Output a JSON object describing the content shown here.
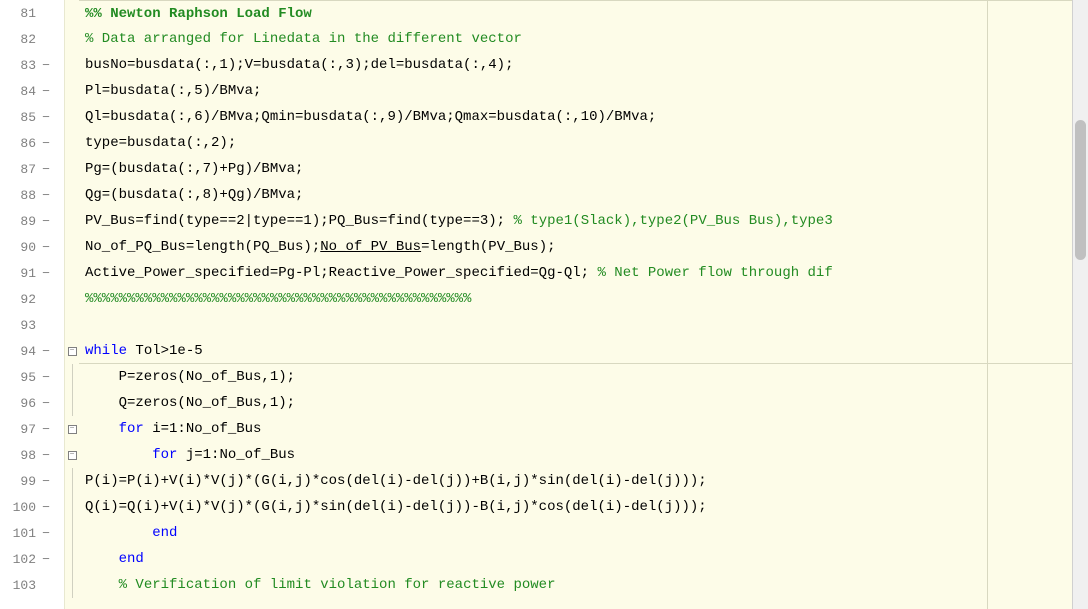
{
  "lines": [
    {
      "num": "81",
      "marker": "",
      "fold": "",
      "tokens": [
        {
          "cls": "section-title",
          "text": "%% Newton Raphson Load Flow"
        }
      ],
      "section": true
    },
    {
      "num": "82",
      "marker": "",
      "fold": "",
      "tokens": [
        {
          "cls": "comment",
          "text": "% Data arranged for Linedata in the different vector"
        }
      ]
    },
    {
      "num": "83",
      "marker": "−",
      "fold": "",
      "tokens": [
        {
          "cls": "text-code",
          "text": "busNo=busdata(:,1);V=busdata(:,3);del=busdata(:,4);"
        }
      ]
    },
    {
      "num": "84",
      "marker": "−",
      "fold": "",
      "tokens": [
        {
          "cls": "text-code",
          "text": "Pl=busdata(:,5)/BMva;"
        }
      ]
    },
    {
      "num": "85",
      "marker": "−",
      "fold": "",
      "tokens": [
        {
          "cls": "text-code",
          "text": "Ql=busdata(:,6)/BMva;Qmin=busdata(:,9)/BMva;Qmax=busdata(:,10)/BMva;"
        }
      ]
    },
    {
      "num": "86",
      "marker": "−",
      "fold": "",
      "tokens": [
        {
          "cls": "text-code",
          "text": "type=busdata(:,2);"
        }
      ]
    },
    {
      "num": "87",
      "marker": "−",
      "fold": "",
      "tokens": [
        {
          "cls": "text-code",
          "text": "Pg=(busdata(:,7)+Pg)/BMva;"
        }
      ]
    },
    {
      "num": "88",
      "marker": "−",
      "fold": "",
      "tokens": [
        {
          "cls": "text-code",
          "text": "Qg=(busdata(:,8)+Qg)/BMva;"
        }
      ]
    },
    {
      "num": "89",
      "marker": "−",
      "fold": "",
      "tokens": [
        {
          "cls": "text-code",
          "text": "PV_Bus=find(type==2|type==1);PQ_Bus=find(type==3); "
        },
        {
          "cls": "comment",
          "text": "% type1(Slack),type2(PV_Bus Bus),type3"
        }
      ]
    },
    {
      "num": "90",
      "marker": "−",
      "fold": "",
      "tokens": [
        {
          "cls": "text-code",
          "text": "No_of_PQ_Bus=length(PQ_Bus);"
        },
        {
          "cls": "text-code underlined",
          "text": "No_of_PV_Bus"
        },
        {
          "cls": "text-code",
          "text": "=length(PV_Bus);"
        }
      ]
    },
    {
      "num": "91",
      "marker": "−",
      "fold": "",
      "tokens": [
        {
          "cls": "text-code",
          "text": "Active_Power_specified=Pg-Pl;Reactive_Power_specified=Qg-Ql; "
        },
        {
          "cls": "comment",
          "text": "% Net Power flow through dif"
        }
      ]
    },
    {
      "num": "92",
      "marker": "",
      "fold": "",
      "tokens": [
        {
          "cls": "comment",
          "text": "%%%%%%%%%%%%%%%%%%%%%%%%%%%%%%%%%%%%%%%%%%%%%%"
        }
      ]
    },
    {
      "num": "93",
      "marker": "",
      "fold": "",
      "tokens": []
    },
    {
      "num": "94",
      "marker": "−",
      "fold": "box",
      "tokens": [
        {
          "cls": "keyword",
          "text": "while"
        },
        {
          "cls": "text-code",
          "text": " Tol>1e-5"
        }
      ],
      "sectionBottom": true
    },
    {
      "num": "95",
      "marker": "−",
      "fold": "line",
      "tokens": [
        {
          "cls": "text-code",
          "text": "    P=zeros(No_of_Bus,1);"
        }
      ]
    },
    {
      "num": "96",
      "marker": "−",
      "fold": "line",
      "tokens": [
        {
          "cls": "text-code",
          "text": "    Q=zeros(No_of_Bus,1);"
        }
      ]
    },
    {
      "num": "97",
      "marker": "−",
      "fold": "box",
      "tokens": [
        {
          "cls": "text-code",
          "text": "    "
        },
        {
          "cls": "keyword",
          "text": "for"
        },
        {
          "cls": "text-code",
          "text": " i=1:No_of_Bus"
        }
      ]
    },
    {
      "num": "98",
      "marker": "−",
      "fold": "box",
      "tokens": [
        {
          "cls": "text-code",
          "text": "        "
        },
        {
          "cls": "keyword",
          "text": "for"
        },
        {
          "cls": "text-code",
          "text": " j=1:No_of_Bus"
        }
      ]
    },
    {
      "num": "99",
      "marker": "−",
      "fold": "line",
      "tokens": [
        {
          "cls": "text-code",
          "text": "P(i)=P(i)+V(i)*V(j)*(G(i,j)*cos(del(i)-del(j))+B(i,j)*sin(del(i)-del(j)));"
        }
      ]
    },
    {
      "num": "100",
      "marker": "−",
      "fold": "line",
      "tokens": [
        {
          "cls": "text-code",
          "text": "Q(i)=Q(i)+V(i)*V(j)*(G(i,j)*sin(del(i)-del(j))-B(i,j)*cos(del(i)-del(j)));"
        }
      ]
    },
    {
      "num": "101",
      "marker": "−",
      "fold": "line",
      "tokens": [
        {
          "cls": "text-code",
          "text": "        "
        },
        {
          "cls": "keyword",
          "text": "end"
        }
      ]
    },
    {
      "num": "102",
      "marker": "−",
      "fold": "line",
      "tokens": [
        {
          "cls": "text-code",
          "text": "    "
        },
        {
          "cls": "keyword",
          "text": "end"
        }
      ]
    },
    {
      "num": "103",
      "marker": "",
      "fold": "line",
      "tokens": [
        {
          "cls": "text-code",
          "text": "    "
        },
        {
          "cls": "comment",
          "text": "% Verification of limit violation for reactive power"
        }
      ]
    }
  ]
}
